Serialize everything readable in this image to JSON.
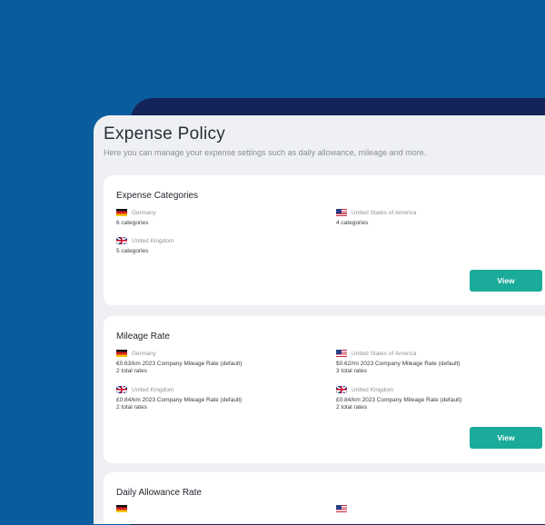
{
  "page": {
    "title": "Expense Policy",
    "subtitle": "Here you can manage your expense settings such as daily allowance, mileage and more."
  },
  "expense_categories": {
    "title": "Expense Categories",
    "entries": [
      {
        "flag": "germany-flag-icon",
        "country": "Germany",
        "count": "6 categories"
      },
      {
        "flag": "usa-flag-icon",
        "country": "United States of America",
        "count": "4 categories"
      },
      {
        "flag": "uk-flag-icon",
        "country": "United Kingdom",
        "count": "5 categories"
      }
    ],
    "view_label": "View"
  },
  "mileage_rate": {
    "title": "Mileage Rate",
    "entries": [
      {
        "flag": "germany-flag-icon",
        "country": "Germany",
        "rate": "€0.63/km 2023 Company Mileage Rate (default)",
        "total": "2 total rates"
      },
      {
        "flag": "usa-flag-icon",
        "country": "United States of America",
        "rate": "$0.62/mi 2023 Company Mileage Rate (default)",
        "total": "3 total rates"
      },
      {
        "flag": "uk-flag-icon",
        "country": "United Kingdom",
        "rate": "£0.84/km 2023 Company Mileage Rate (default)",
        "total": "2 total rates"
      },
      {
        "flag": "uk-flag-icon",
        "country": "United Kingdom",
        "rate": "£0.84/km 2023 Company Mileage Rate (default)",
        "total": "2 total rates"
      }
    ],
    "view_label": "View"
  },
  "daily_allowance": {
    "title": "Daily Allowance Rate"
  },
  "colors": {
    "background": "#0a5d9c",
    "back_panel": "#13245a",
    "content_bg": "#eff0f4",
    "accent": "#1aab9a"
  }
}
